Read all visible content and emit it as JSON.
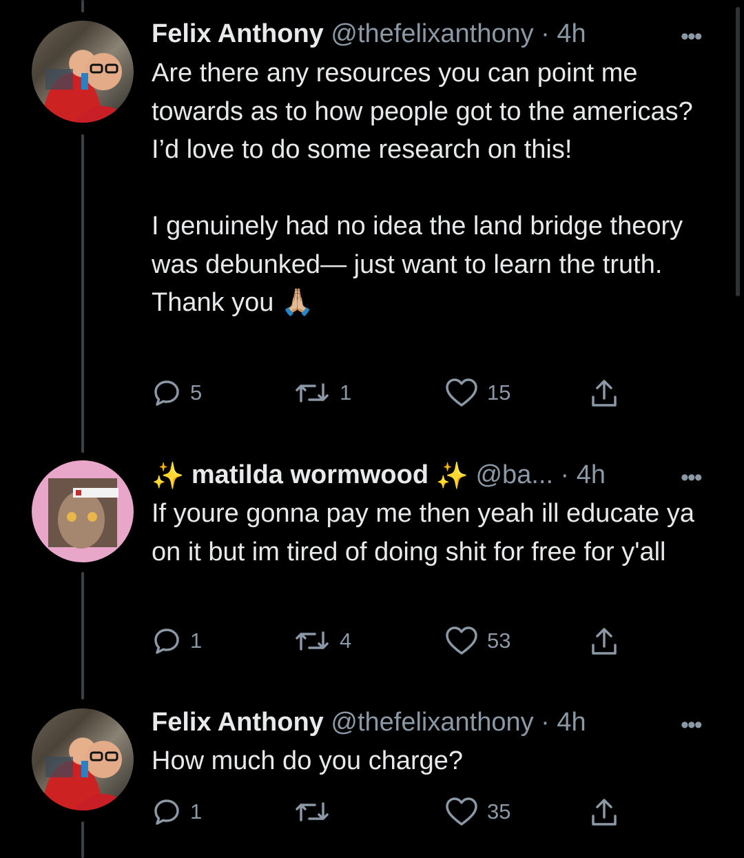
{
  "tweets": [
    {
      "name": "Felix Anthony",
      "handle": "@thefelixanthony",
      "sep": " · ",
      "time": "4h",
      "body": "Are there any resources you can point me towards as to how people got to the americas? I’d love to do some research on this!\n\nI genuinely had no idea the land bridge theory was debunked— just want to learn the truth. Thank you 🙏🏼",
      "replies": "5",
      "retweets": "1",
      "likes": "15",
      "avatar_icon": "profile-photo-man-glasses"
    },
    {
      "name_prefix": "✨",
      "name": "matilda wormwood",
      "name_suffix": "✨",
      "handle": "@ba...",
      "sep": " · ",
      "time": "4h",
      "body": "If youre gonna pay me then yeah ill educate ya on it but im tired of doing shit for free for y'all",
      "replies": "1",
      "retweets": "4",
      "likes": "53",
      "avatar_icon": "profile-photo-pink-frame"
    },
    {
      "name": "Felix Anthony",
      "handle": "@thefelixanthony",
      "sep": " · ",
      "time": "4h",
      "body": "How much do you charge?",
      "replies": "1",
      "retweets": "",
      "likes": "35",
      "avatar_icon": "profile-photo-man-glasses"
    }
  ],
  "more_label": "•••",
  "colors": {
    "background": "#000000",
    "text": "#e7e9ea",
    "muted": "#8b98a5",
    "thread_line": "#3e4144"
  }
}
